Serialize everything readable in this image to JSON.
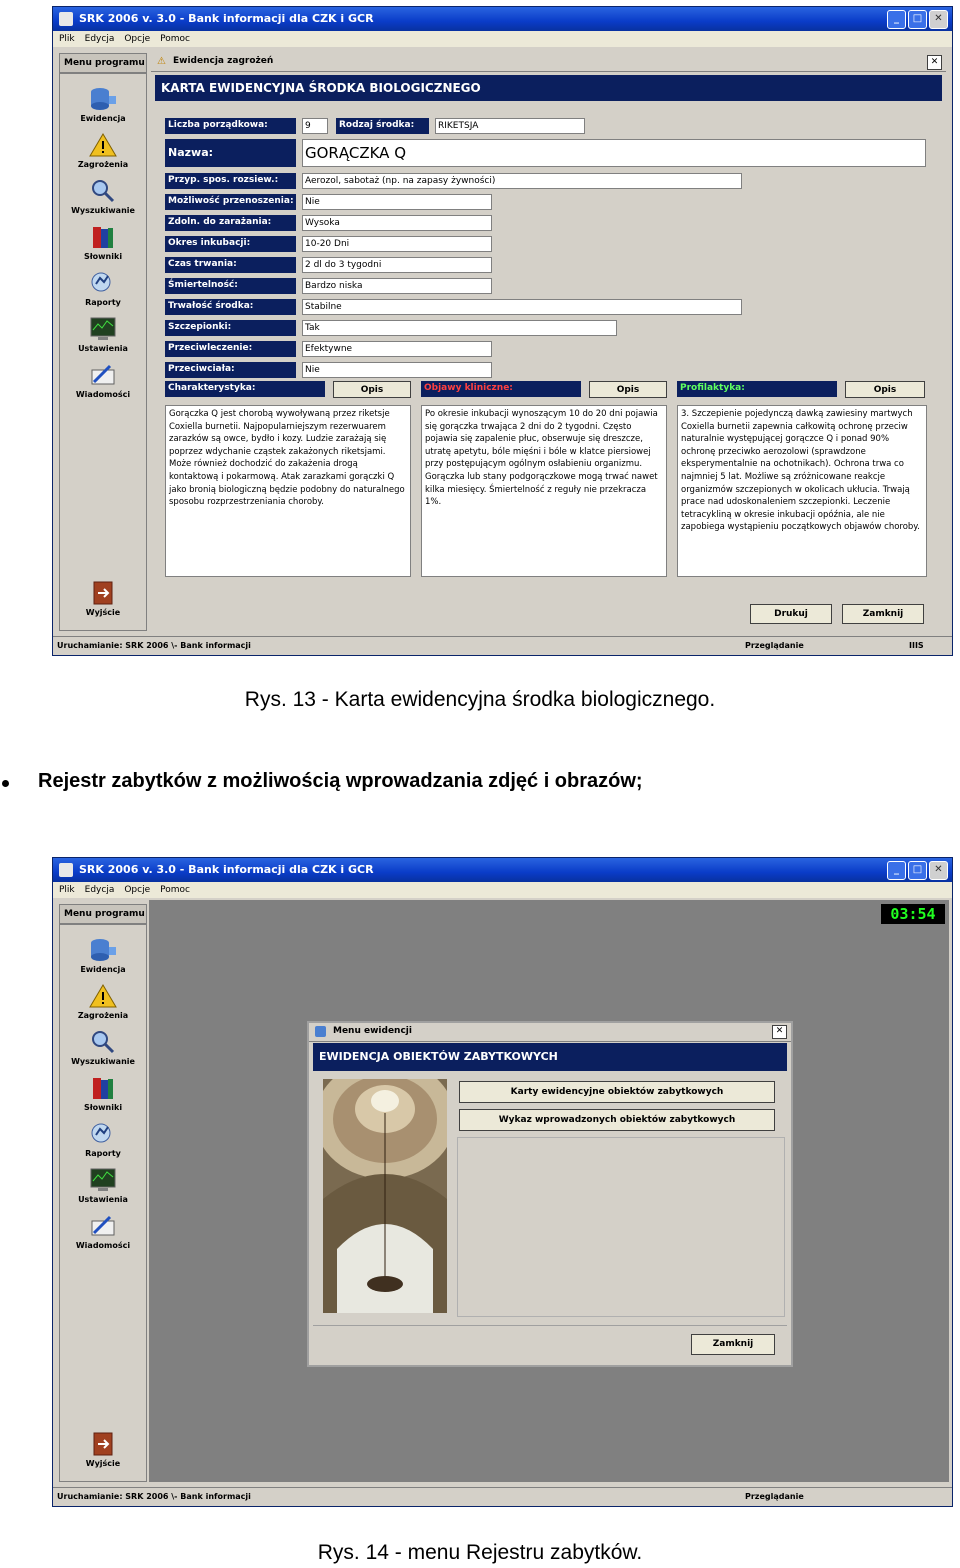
{
  "app": {
    "title": "SRK 2006 v. 3.0 - Bank informacji dla CZK i GCR",
    "menu": [
      "Plik",
      "Edycja",
      "Opcje",
      "Pomoc"
    ],
    "sidebar_title": "Menu programu",
    "sidebar_items": [
      "Ewidencja",
      "Zagrożenia",
      "Wyszukiwanie",
      "Słowniki",
      "Raporty",
      "Ustawienia",
      "Wiadomości"
    ],
    "exit_label": "Wyjście",
    "status_left": "Uruchamianie: SRK 2006 \\- Bank informacji"
  },
  "screen1": {
    "panel_title": "Ewidencja zagrożeń",
    "header": "KARTA EWIDENCYJNA ŚRODKA BIOLOGICZNEGO",
    "liczba_label": "Liczba porządkowa:",
    "liczba_value": "9",
    "rodzaj_label": "Rodzaj środka:",
    "rodzaj_value": "RIKETSJA",
    "nazwa_label": "Nazwa:",
    "nazwa_value": "GORĄCZKA Q",
    "fields": [
      {
        "label": "Przyp. spos. rozsiew.:",
        "value": "Aerozol, sabotaż (np. na zapasy żywności)"
      },
      {
        "label": "Możliwość przenoszenia:",
        "value": "Nie"
      },
      {
        "label": "Zdoln. do zarażania:",
        "value": "Wysoka"
      },
      {
        "label": "Okres inkubacji:",
        "value": "10-20 Dni"
      },
      {
        "label": "Czas trwania:",
        "value": "2 dl do 3 tygodni"
      },
      {
        "label": "Śmiertelność:",
        "value": "Bardzo niska"
      },
      {
        "label": "Trwałość środka:",
        "value": "Stabilne"
      },
      {
        "label": "Szczepionki:",
        "value": "Tak"
      },
      {
        "label": "Przeciwleczenie:",
        "value": "Efektywne"
      },
      {
        "label": "Przeciwciała:",
        "value": "Nie"
      }
    ],
    "sections": [
      {
        "label": "Charakterystyka:",
        "button": "Opis",
        "text": "Gorączka Q jest chorobą wywoływaną przez riketsje Coxiella burnetii. Najpopularniejszym rezerwuarem zarazków są owce, bydło i kozy. Ludzie zarażają się poprzez wdychanie cząstek zakażonych riketsjami. Może również dochodzić do zakażenia drogą kontaktową i pokarmową. Atak zarazkami gorączki Q jako bronią biologiczną będzie podobny do naturalnego sposobu rozprzestrzeniania choroby."
      },
      {
        "label": "Objawy kliniczne:",
        "button": "Opis",
        "text": "Po okresie inkubacji wynoszącym 10 do 20 dni pojawia się gorączka trwająca 2 dni do 2 tygodni. Często pojawia się zapalenie płuc, obserwuje się dreszcze, utratę apetytu, bóle mięśni i bóle w klatce piersiowej przy postępującym ogólnym osłabieniu organizmu. Gorączka lub stany podgorączkowe mogą trwać nawet kilka miesięcy. Śmiertelność z reguły nie przekracza 1%."
      },
      {
        "label": "Profilaktyka:",
        "button": "Opis",
        "text": "3. Szczepienie pojedynczą dawką zawiesiny martwych Coxiella burnetii zapewnia całkowitą ochronę przeciw naturalnie występującej gorączce Q i ponad 90% ochronę przeciwko aerozolowi (sprawdzone eksperymentalnie na ochotnikach). Ochrona trwa co najmniej 5 lat. Możliwe są zróżnicowane reakcje organizmów szczepionych w okolicach ukłucia. Trwają prace nad udoskonaleniem szczepionki. Leczenie tetracykliną w okresie inkubacji opóźnia, ale nie zapobiega wystąpieniu początkowych objawów choroby."
      }
    ],
    "print_button": "Drukuj",
    "close_button": "Zamknij",
    "status_mid": "Przeglądanie",
    "status_right": "IIIS"
  },
  "caption1": "Rys. 13 - Karta ewidencyjna środka biologicznego.",
  "bullet": "Rejestr zabytków z możliwością wprowadzania zdjęć i obrazów;",
  "screen2": {
    "clock": "03:54",
    "dialog_title": "Menu ewidencji",
    "dialog_header": "EWIDENCJA OBIEKTÓW ZABYTKOWYCH",
    "btn_cards": "Karty ewidencyjne obiektów zabytkowych",
    "btn_list": "Wykaz wprowadzonych obiektów zabytkowych",
    "close_button": "Zamknij",
    "status_mid": "Przeglądanie"
  },
  "caption2": "Rys. 14 - menu Rejestru zabytków."
}
